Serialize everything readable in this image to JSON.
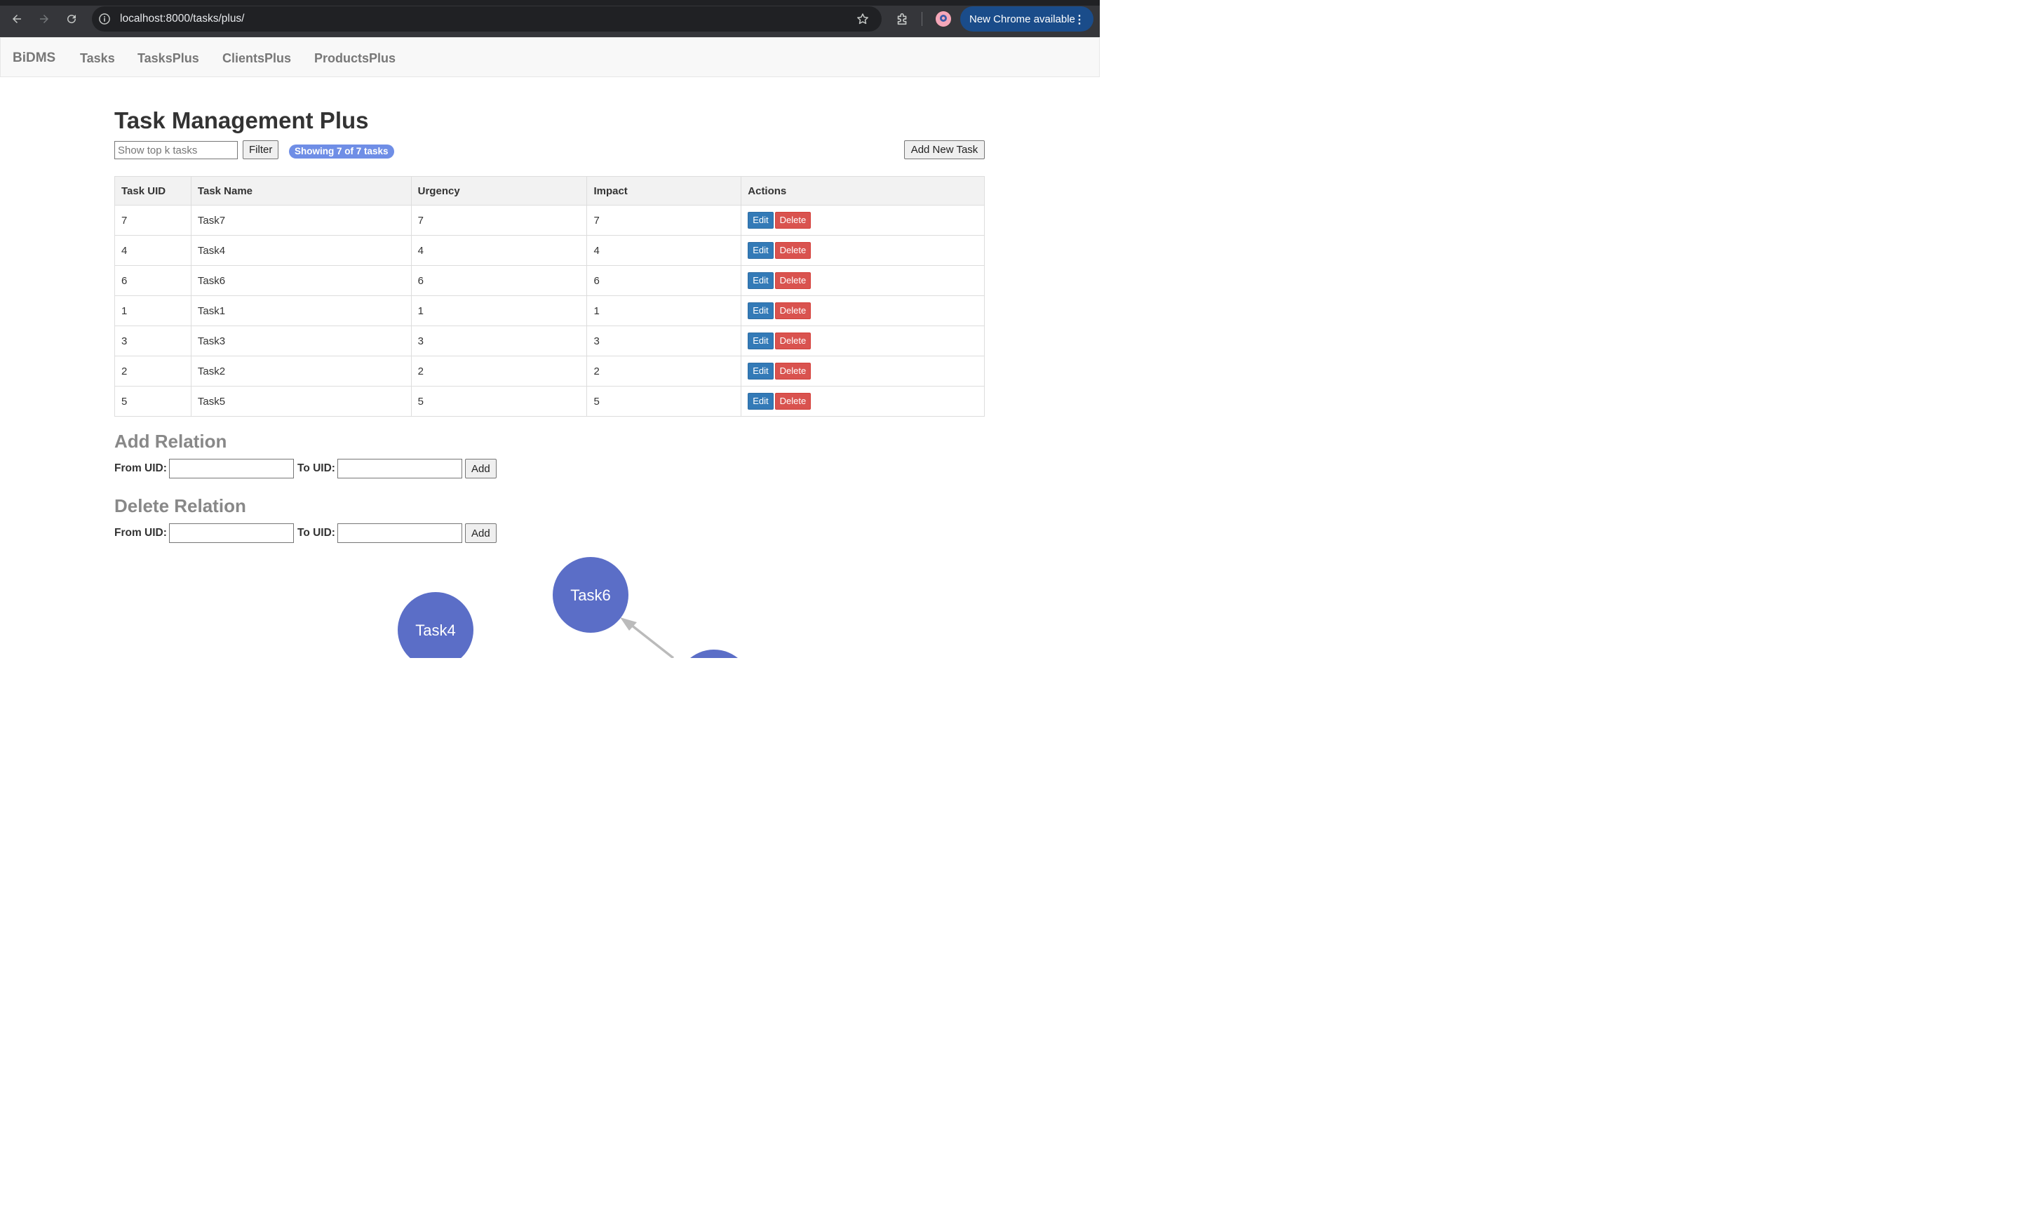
{
  "browser": {
    "url": "localhost:8000/tasks/plus/",
    "update_label": "New Chrome available"
  },
  "navbar": {
    "brand": "BiDMS",
    "links": [
      "Tasks",
      "TasksPlus",
      "ClientsPlus",
      "ProductsPlus"
    ]
  },
  "page": {
    "title": "Task Management Plus",
    "filter_placeholder": "Show top k tasks",
    "filter_button": "Filter",
    "badge": "Showing 7 of 7 tasks",
    "add_task_button": "Add New Task"
  },
  "table": {
    "headers": [
      "Task UID",
      "Task Name",
      "Urgency",
      "Impact",
      "Actions"
    ],
    "rows": [
      {
        "uid": "7",
        "name": "Task7",
        "urgency": "7",
        "impact": "7"
      },
      {
        "uid": "4",
        "name": "Task4",
        "urgency": "4",
        "impact": "4"
      },
      {
        "uid": "6",
        "name": "Task6",
        "urgency": "6",
        "impact": "6"
      },
      {
        "uid": "1",
        "name": "Task1",
        "urgency": "1",
        "impact": "1"
      },
      {
        "uid": "3",
        "name": "Task3",
        "urgency": "3",
        "impact": "3"
      },
      {
        "uid": "2",
        "name": "Task2",
        "urgency": "2",
        "impact": "2"
      },
      {
        "uid": "5",
        "name": "Task5",
        "urgency": "5",
        "impact": "5"
      }
    ],
    "edit_label": "Edit",
    "delete_label": "Delete"
  },
  "add_relation": {
    "heading": "Add Relation",
    "from_label": "From UID:",
    "to_label": "To UID:",
    "button": "Add"
  },
  "delete_relation": {
    "heading": "Delete Relation",
    "from_label": "From UID:",
    "to_label": "To UID:",
    "button": "Add"
  },
  "graph": {
    "nodes": [
      {
        "label": "Task6"
      },
      {
        "label": "Task4"
      }
    ],
    "node_color": "#5b6ec7",
    "edge_color": "#bbbbbb"
  },
  "icons": [
    "back-arrow-icon",
    "forward-arrow-icon",
    "reload-icon",
    "site-info-icon",
    "bookmark-star-icon",
    "extensions-icon",
    "profile-avatar",
    "menu-dots-icon"
  ]
}
